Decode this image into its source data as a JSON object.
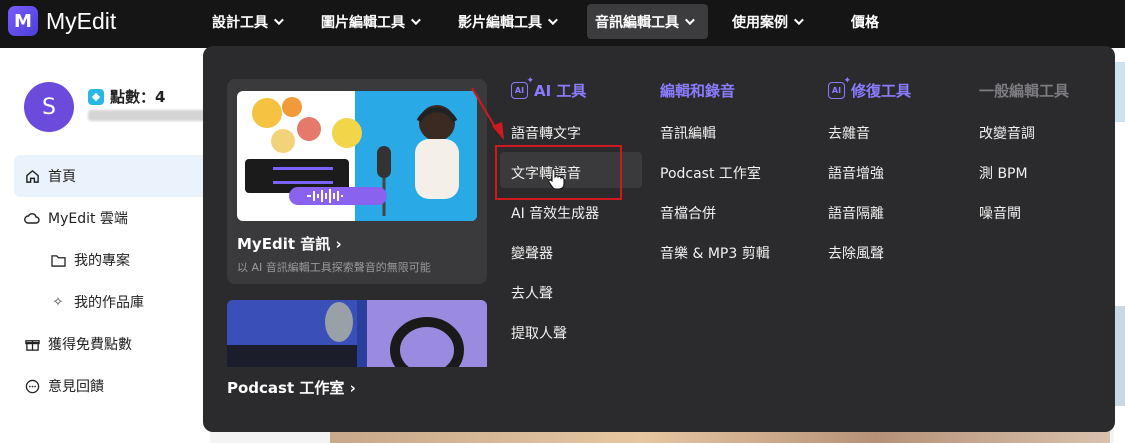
{
  "app": {
    "name": "MyEdit",
    "logo_letter": "M"
  },
  "nav": [
    {
      "label": "設計工具",
      "active": false
    },
    {
      "label": "圖片編輯工具",
      "active": false
    },
    {
      "label": "影片編輯工具",
      "active": false
    },
    {
      "label": "音訊編輯工具",
      "active": true
    },
    {
      "label": "使用案例",
      "active": false
    },
    {
      "label": "價格",
      "active": false
    }
  ],
  "user": {
    "avatar_letter": "S",
    "points_label": "點數：4"
  },
  "sidebar": {
    "items": [
      {
        "label": "首頁",
        "icon": "home-icon"
      },
      {
        "label": "MyEdit 雲端",
        "icon": "cloud-icon"
      },
      {
        "label": "我的專案",
        "icon": "folder-icon"
      },
      {
        "label": "我的作品庫",
        "icon": "sparkle-icon"
      },
      {
        "label": "獲得免費點數",
        "icon": "gift-icon"
      },
      {
        "label": "意見回饋",
        "icon": "chat-icon"
      }
    ]
  },
  "menu": {
    "feature": {
      "title": "MyEdit 音訊 ›",
      "subtitle": "以 AI 音訊編輯工具探索聲音的無限可能"
    },
    "podcast": {
      "title": "Podcast 工作室 ›"
    },
    "columns": [
      {
        "heading": "AI 工具",
        "style": "purple",
        "icon": "ai-icon",
        "links": [
          "語音轉文字",
          "文字轉語音",
          "AI 音效生成器",
          "變聲器",
          "去人聲",
          "提取人聲"
        ]
      },
      {
        "heading": "編輯和錄音",
        "style": "purple",
        "icon": "",
        "links": [
          "音訊編輯",
          "Podcast 工作室",
          "音檔合併",
          "音樂 & MP3 剪輯"
        ]
      },
      {
        "heading": "修復工具",
        "style": "purple",
        "icon": "ai-icon",
        "links": [
          "去雜音",
          "語音增強",
          "語音隔離",
          "去除風聲"
        ]
      },
      {
        "heading": "一般編輯工具",
        "style": "gray",
        "icon": "",
        "links": [
          "改變音調",
          "測 BPM",
          "噪音閘"
        ]
      }
    ],
    "highlighted_link": "文字轉語音"
  },
  "colors": {
    "accent": "#8b7bff",
    "menu_bg": "#2b2b2d",
    "annotation": "#d0191e"
  }
}
